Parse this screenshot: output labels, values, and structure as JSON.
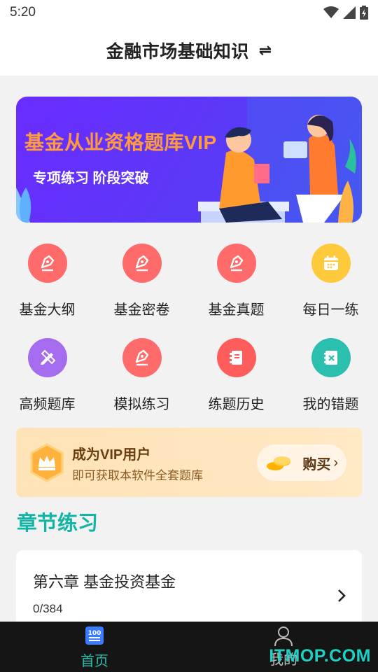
{
  "status_bar": {
    "time": "5:20"
  },
  "header": {
    "title": "金融市场基础知识",
    "switch_icon": "⇌"
  },
  "banner": {
    "title": "基金从业资格题库VIP",
    "subtitle": "专项练习 阶段突破"
  },
  "grid": {
    "items": [
      {
        "label": "基金大纲",
        "icon": "pen-icon",
        "color": "#ff6b6b"
      },
      {
        "label": "基金密卷",
        "icon": "pen-icon",
        "color": "#ff6b6b"
      },
      {
        "label": "基金真题",
        "icon": "pen-icon",
        "color": "#ff6b6b"
      },
      {
        "label": "每日一练",
        "icon": "calendar-icon",
        "color": "#ffc93c"
      },
      {
        "label": "高频题库",
        "icon": "pencil-ruler-icon",
        "color": "#a56cf0"
      },
      {
        "label": "模拟练习",
        "icon": "pen-icon",
        "color": "#ff6b6b"
      },
      {
        "label": "练题历史",
        "icon": "notebook-icon",
        "color": "#ff5c5c"
      },
      {
        "label": "我的错题",
        "icon": "wrong-book-icon",
        "color": "#2bbfb0"
      }
    ]
  },
  "vip": {
    "title": "成为VIP用户",
    "desc": "即可获取本软件全套题库",
    "buy_label": "购买"
  },
  "section": {
    "title": "章节练习"
  },
  "chapter": {
    "title": "第六章 基金投资基金",
    "progress": "0/384"
  },
  "tabs": [
    {
      "label": "首页",
      "icon": "home-100-icon",
      "active": true
    },
    {
      "label": "我的",
      "icon": "user-icon",
      "active": false
    }
  ],
  "watermark": "ITMOP.COM",
  "colors": {
    "accent": "#12b4a4",
    "tab_active": "#2bbfb0",
    "banner": "#6a2cff"
  }
}
